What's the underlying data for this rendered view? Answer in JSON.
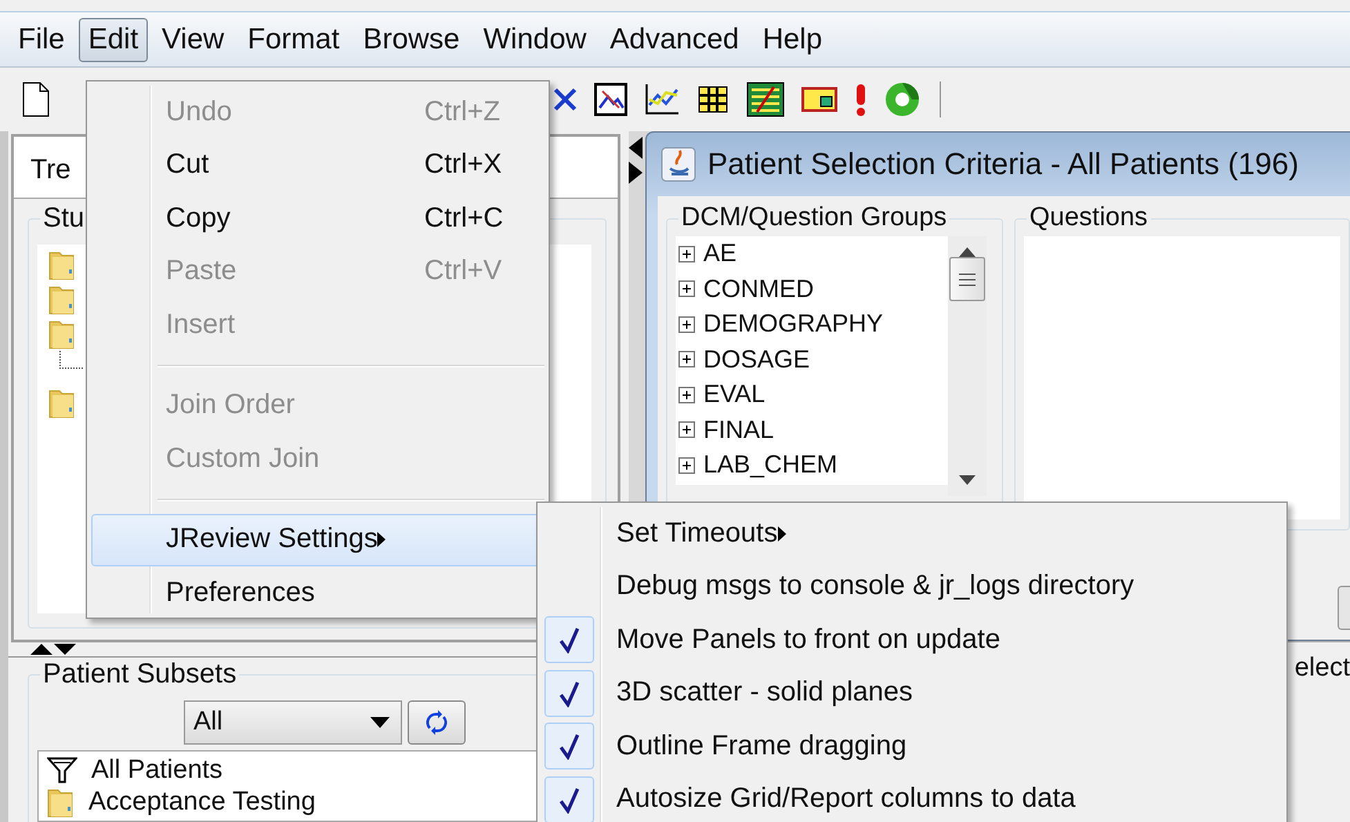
{
  "menubar": [
    {
      "label": "File",
      "selected": false
    },
    {
      "label": "Edit",
      "selected": true
    },
    {
      "label": "View",
      "selected": false
    },
    {
      "label": "Format",
      "selected": false
    },
    {
      "label": "Browse",
      "selected": false
    },
    {
      "label": "Window",
      "selected": false
    },
    {
      "label": "Advanced",
      "selected": false
    },
    {
      "label": "Help",
      "selected": false
    }
  ],
  "tree_panel": {
    "tab": "Tre",
    "group": "Stu"
  },
  "patient_subsets": {
    "title": "Patient Subsets",
    "filter": "All",
    "items": [
      {
        "label": "All Patients",
        "kind": "filter"
      },
      {
        "label": "Acceptance Testing",
        "kind": "folder"
      }
    ]
  },
  "selection_window": {
    "title": "Patient Selection Criteria - All Patients (196)",
    "groups_title": "DCM/Question Groups",
    "groups": [
      {
        "label": "AE",
        "expanded": false
      },
      {
        "label": "CONMED",
        "expanded": false
      },
      {
        "label": "DEMOGRAPHY",
        "expanded": false
      },
      {
        "label": "DOSAGE",
        "expanded": false
      },
      {
        "label": "EVAL",
        "expanded": false
      },
      {
        "label": "FINAL",
        "expanded": false
      },
      {
        "label": "LAB_CHEM",
        "expanded": false
      }
    ],
    "questions_title": "Questions",
    "side_text": "elect"
  },
  "edit_menu": [
    {
      "kind": "item",
      "label": "Undo",
      "shortcut": "Ctrl+Z",
      "disabled": true,
      "selected": false,
      "has_submenu": false
    },
    {
      "kind": "item",
      "label": "Cut",
      "shortcut": "Ctrl+X",
      "disabled": false,
      "selected": false,
      "has_submenu": false
    },
    {
      "kind": "item",
      "label": "Copy",
      "shortcut": "Ctrl+C",
      "disabled": false,
      "selected": false,
      "has_submenu": false
    },
    {
      "kind": "item",
      "label": "Paste",
      "shortcut": "Ctrl+V",
      "disabled": true,
      "selected": false,
      "has_submenu": false
    },
    {
      "kind": "item",
      "label": "Insert",
      "disabled": true,
      "selected": false,
      "has_submenu": false
    },
    {
      "kind": "separator"
    },
    {
      "kind": "item",
      "label": "Join Order",
      "disabled": true,
      "selected": false,
      "has_submenu": false
    },
    {
      "kind": "item",
      "label": "Custom Join",
      "disabled": true,
      "selected": false,
      "has_submenu": false
    },
    {
      "kind": "separator"
    },
    {
      "kind": "item",
      "label": "JReview Settings",
      "disabled": false,
      "selected": true,
      "has_submenu": true
    },
    {
      "kind": "item",
      "label": "Preferences",
      "disabled": false,
      "selected": false,
      "has_submenu": false
    }
  ],
  "settings_submenu": [
    {
      "label": "Set Timeouts",
      "checked": false,
      "has_submenu": true
    },
    {
      "label": "Debug msgs to console & jr_logs directory",
      "checked": false,
      "has_submenu": false
    },
    {
      "label": "Move Panels to front on update",
      "checked": true,
      "has_submenu": false
    },
    {
      "label": "3D scatter - solid planes",
      "checked": true,
      "has_submenu": false
    },
    {
      "label": "Outline Frame dragging",
      "checked": true,
      "has_submenu": false
    },
    {
      "label": "Autosize Grid/Report columns to data",
      "checked": true,
      "has_submenu": false
    }
  ]
}
